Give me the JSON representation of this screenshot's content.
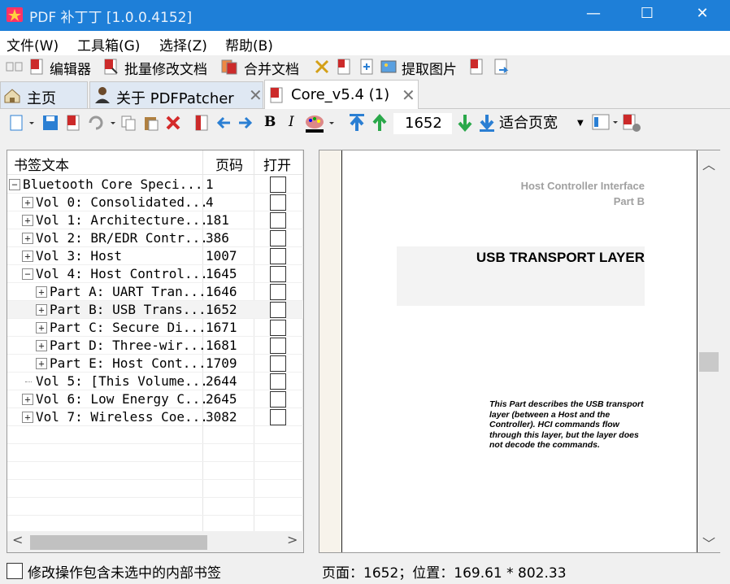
{
  "window": {
    "title": "PDF 补丁丁 [1.0.0.4152]",
    "controls": {
      "minimize": "—",
      "maximize": "☐",
      "close": "✕"
    }
  },
  "menu": [
    "文件(W)",
    "工具箱(G)",
    "选择(Z)",
    "帮助(B)"
  ],
  "toolbar1": {
    "items": [
      "编辑器",
      "批量修改文档",
      "合并文档",
      "提取图片"
    ]
  },
  "tabs": [
    {
      "label": "主页"
    },
    {
      "label": "关于 PDFPatcher"
    },
    {
      "label": "Core_v5.4 (1)"
    }
  ],
  "toolbar2": {
    "page_number": "1652",
    "zoom": "适合页宽",
    "bold_label": "B",
    "italic_label": "I"
  },
  "bookmarks": {
    "columns": [
      "书签文本",
      "页码",
      "打开"
    ],
    "rows": [
      {
        "text": "Bluetooth Core Speci...",
        "page": "1",
        "level": 0,
        "expander": "−"
      },
      {
        "text": "Vol 0: Consolidated...",
        "page": "4",
        "level": 1,
        "expander": "+"
      },
      {
        "text": "Vol 1: Architecture...",
        "page": "181",
        "level": 1,
        "expander": "+"
      },
      {
        "text": "Vol 2: BR/EDR Contr...",
        "page": "386",
        "level": 1,
        "expander": "+"
      },
      {
        "text": "Vol 3: Host",
        "page": "1007",
        "level": 1,
        "expander": "+"
      },
      {
        "text": "Vol 4: Host Control...",
        "page": "1645",
        "level": 1,
        "expander": "−"
      },
      {
        "text": "Part A: UART Tran...",
        "page": "1646",
        "level": 2,
        "expander": "+"
      },
      {
        "text": "Part B: USB Trans...",
        "page": "1652",
        "level": 2,
        "expander": "+",
        "selected": true
      },
      {
        "text": "Part C: Secure Di...",
        "page": "1671",
        "level": 2,
        "expander": "+"
      },
      {
        "text": "Part D: Three-wir...",
        "page": "1681",
        "level": 2,
        "expander": "+"
      },
      {
        "text": "Part E: Host Cont...",
        "page": "1709",
        "level": 2,
        "expander": "+"
      },
      {
        "text": "Vol 5: [This Volume...",
        "page": "2644",
        "level": 1,
        "expander": ""
      },
      {
        "text": "Vol 6: Low Energy C...",
        "page": "2645",
        "level": 1,
        "expander": "+"
      },
      {
        "text": "Vol 7: Wireless Coe...",
        "page": "3082",
        "level": 1,
        "expander": "+"
      }
    ]
  },
  "page_preview": {
    "header_line1": "Host Controller Interface",
    "header_line2": "Part B",
    "banner": "USB TRANSPORT LAYER",
    "description": "This Part describes the USB transport layer (between a Host and the Controller). HCI commands flow through this layer, but the layer does not decode the commands."
  },
  "footer": {
    "checkbox_label": "修改操作包含未选中的内部书签",
    "status": "页面：1652；位置：169.61 * 802.33"
  },
  "colors": {
    "titlebar": "#1e7fd8",
    "accent_blue": "#2b7fd3",
    "pdf_red": "#cc2a2a"
  }
}
